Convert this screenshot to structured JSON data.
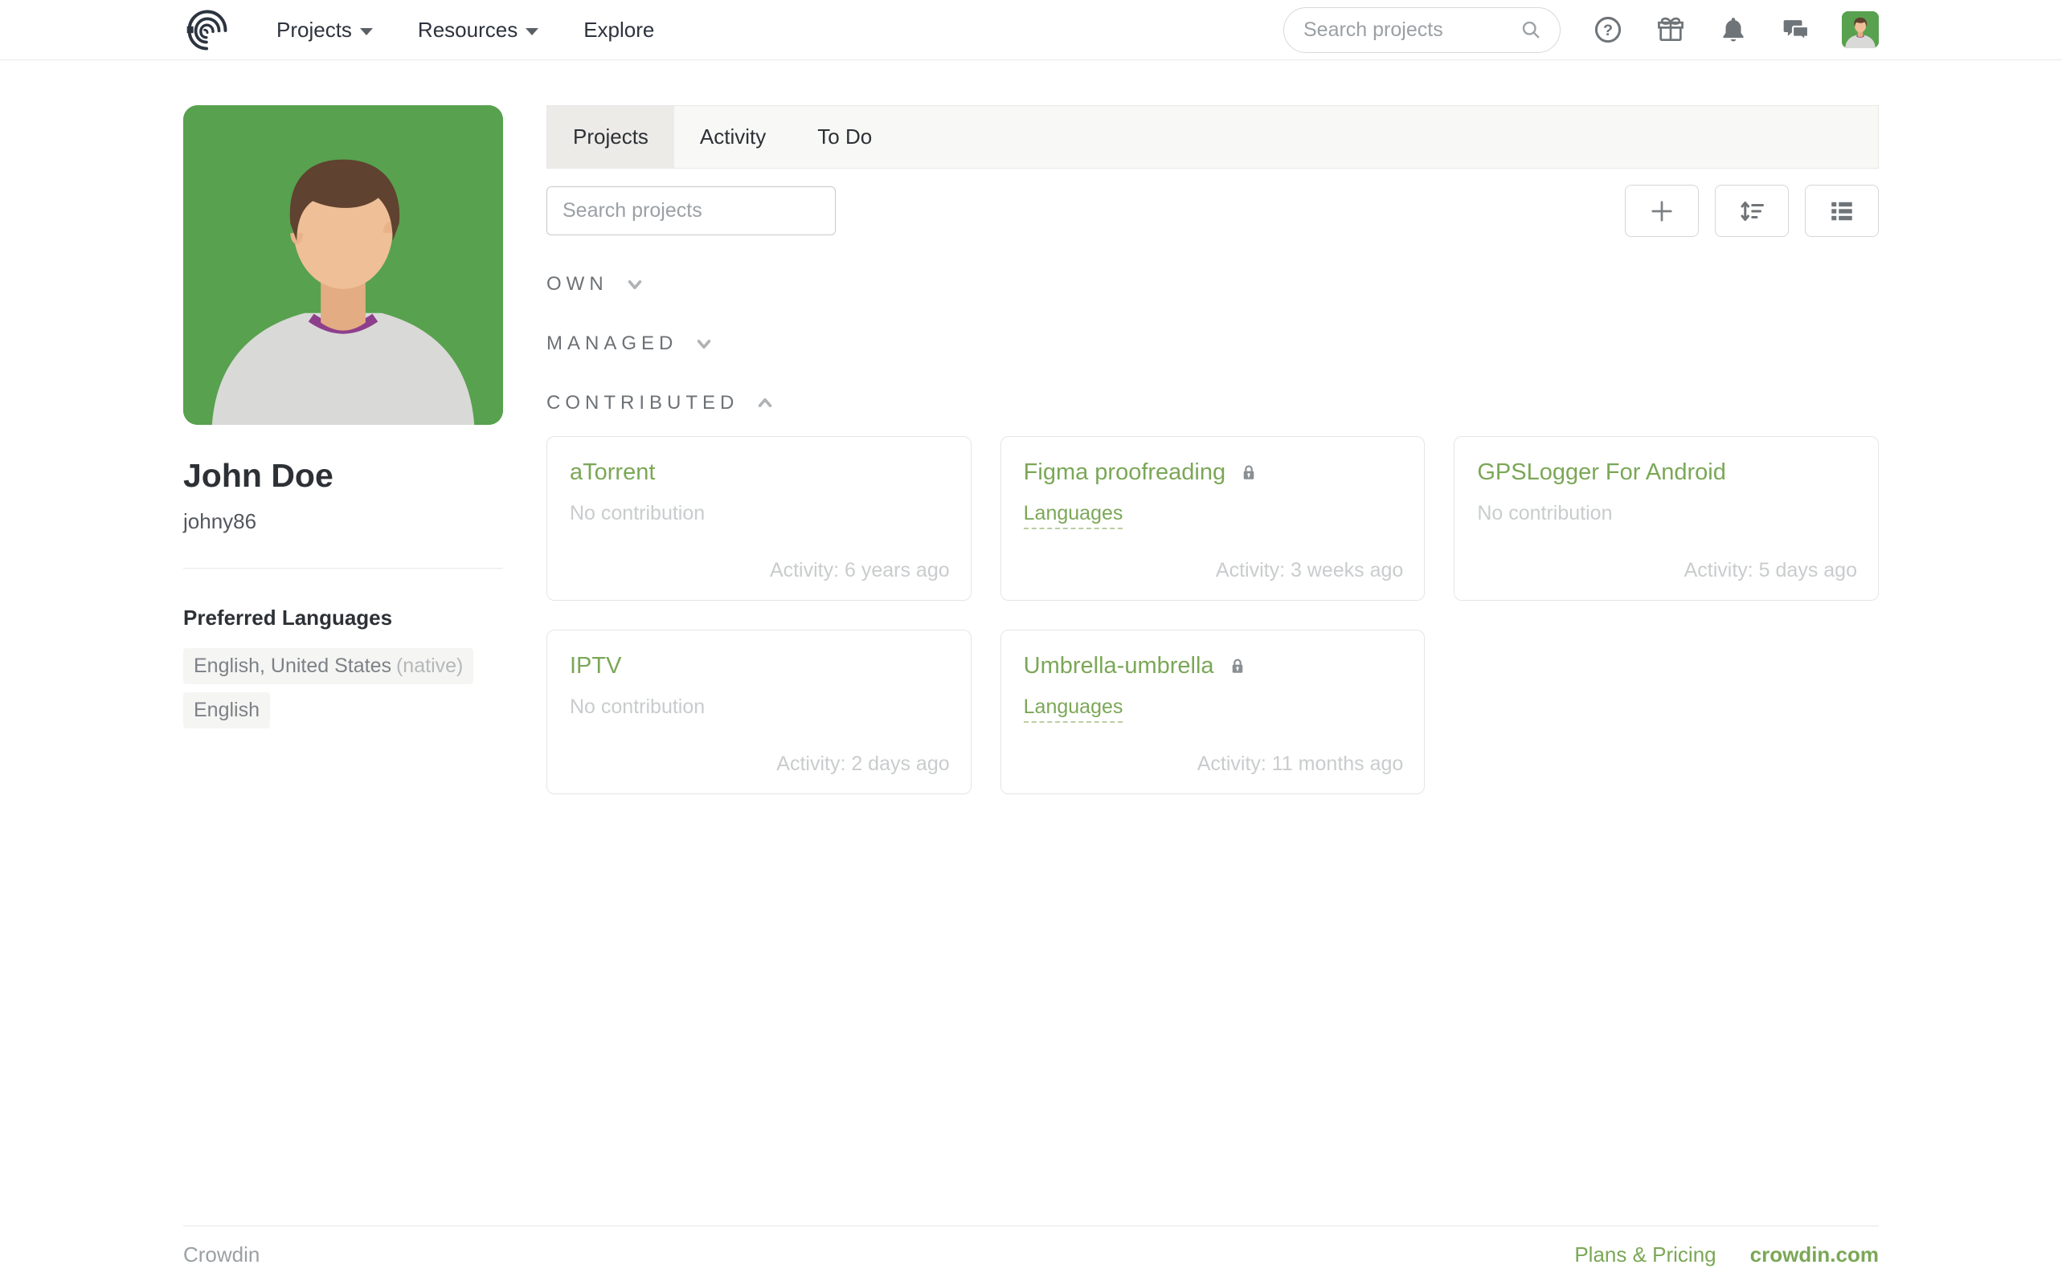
{
  "navbar": {
    "brand": "Crowdin",
    "links": {
      "projects": "Projects",
      "resources": "Resources",
      "explore": "Explore"
    },
    "search": {
      "placeholder": "Search projects"
    },
    "icon_names": [
      "crowdin-logo",
      "help-icon",
      "gift-icon",
      "bell-icon",
      "chat-icon",
      "search-icon",
      "avatar"
    ]
  },
  "profile": {
    "name": "John Doe",
    "username": "johny86",
    "languages_title": "Preferred Languages",
    "languages": [
      {
        "label": "English, United States",
        "note": "(native)"
      },
      {
        "label": "English",
        "note": ""
      }
    ]
  },
  "tabs": [
    {
      "label": "Projects",
      "active": true
    },
    {
      "label": "Activity",
      "active": false
    },
    {
      "label": "To Do",
      "active": false
    }
  ],
  "toolbar": {
    "search_placeholder": "Search projects",
    "buttons": [
      "add-project-button",
      "sort-button",
      "list-view-button"
    ]
  },
  "sections": [
    {
      "label": "OWN",
      "expanded": false
    },
    {
      "label": "MANAGED",
      "expanded": false
    },
    {
      "label": "CONTRIBUTED",
      "expanded": true
    }
  ],
  "projects": [
    {
      "name": "aTorrent",
      "private": false,
      "secondary": "No contribution",
      "secondary_is_link": false,
      "activity": "Activity: 6 years ago"
    },
    {
      "name": "Figma proofreading",
      "private": true,
      "secondary": "Languages",
      "secondary_is_link": true,
      "activity": "Activity: 3 weeks ago"
    },
    {
      "name": "GPSLogger For Android",
      "private": false,
      "secondary": "No contribution",
      "secondary_is_link": false,
      "activity": "Activity: 5 days ago"
    },
    {
      "name": "IPTV",
      "private": false,
      "secondary": "No contribution",
      "secondary_is_link": false,
      "activity": "Activity: 2 days ago"
    },
    {
      "name": "Umbrella-umbrella",
      "private": true,
      "secondary": "Languages",
      "secondary_is_link": true,
      "activity": "Activity: 11 months ago"
    }
  ],
  "footer": {
    "brand": "Crowdin",
    "plans": "Plans & Pricing",
    "site": "crowdin.com"
  },
  "colors": {
    "accent_green": "#7ba757",
    "avatar_green": "#58a14f",
    "muted_text": "#c9cccd",
    "border": "#e5e5e3"
  }
}
